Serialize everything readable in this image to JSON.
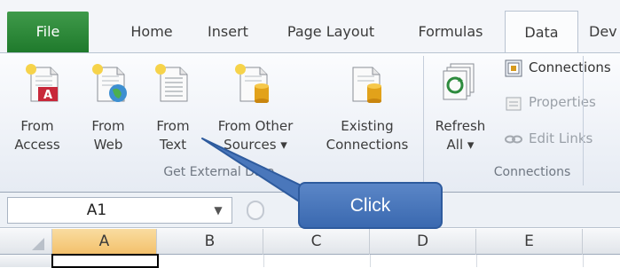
{
  "tabs": {
    "file": "File",
    "home": "Home",
    "insert": "Insert",
    "page_layout": "Page Layout",
    "formulas": "Formulas",
    "data": "Data",
    "developer": "Dev"
  },
  "ribbon": {
    "get_external_data": {
      "group_label": "Get External Data",
      "from_access": [
        "From",
        "Access"
      ],
      "from_web": [
        "From",
        "Web"
      ],
      "from_text": [
        "From",
        "Text"
      ],
      "from_other": [
        "From Other",
        "Sources ▾"
      ],
      "existing": [
        "Existing",
        "Connections"
      ]
    },
    "connections": {
      "group_label": "Connections",
      "refresh": [
        "Refresh",
        "All ▾"
      ],
      "connections": "Connections",
      "properties": "Properties",
      "edit_links": "Edit Links"
    }
  },
  "formula_bar": {
    "name_box": "A1"
  },
  "columns": [
    "A",
    "B",
    "C",
    "D",
    "E"
  ],
  "callout": {
    "text": "Click"
  }
}
